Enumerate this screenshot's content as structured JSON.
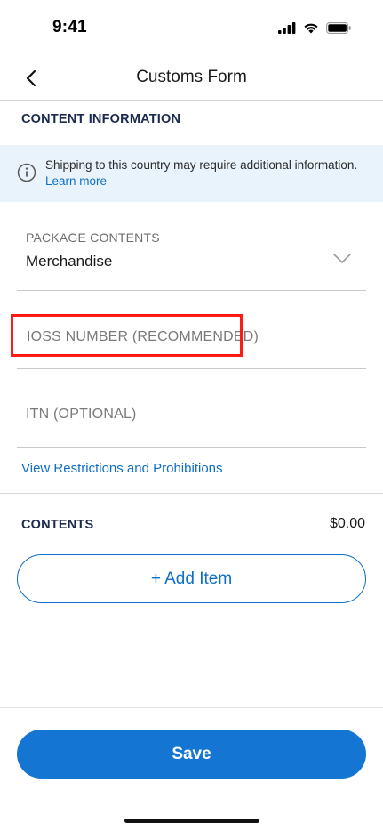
{
  "status_bar": {
    "time": "9:41"
  },
  "nav": {
    "title": "Customs Form"
  },
  "content_section": {
    "heading": "CONTENT INFORMATION"
  },
  "info_banner": {
    "message": "Shipping to this country may require additional information.",
    "link": "Learn more"
  },
  "package_contents": {
    "label": "PACKAGE CONTENTS",
    "value": "Merchandise"
  },
  "ioss": {
    "placeholder": "IOSS NUMBER (RECOMMENDED)"
  },
  "itn": {
    "placeholder": "ITN (OPTIONAL)"
  },
  "restrictions_link": "View Restrictions and Prohibitions",
  "contents_section": {
    "heading": "CONTENTS",
    "total": "$0.00"
  },
  "add_item": {
    "label": "+ Add Item"
  },
  "save": {
    "label": "Save"
  },
  "colors": {
    "accent": "#1476d2",
    "link": "#0f6fc6",
    "heading": "#1b2a4e",
    "banner_bg": "#e8f3fc",
    "highlight": "#ff1a14"
  }
}
